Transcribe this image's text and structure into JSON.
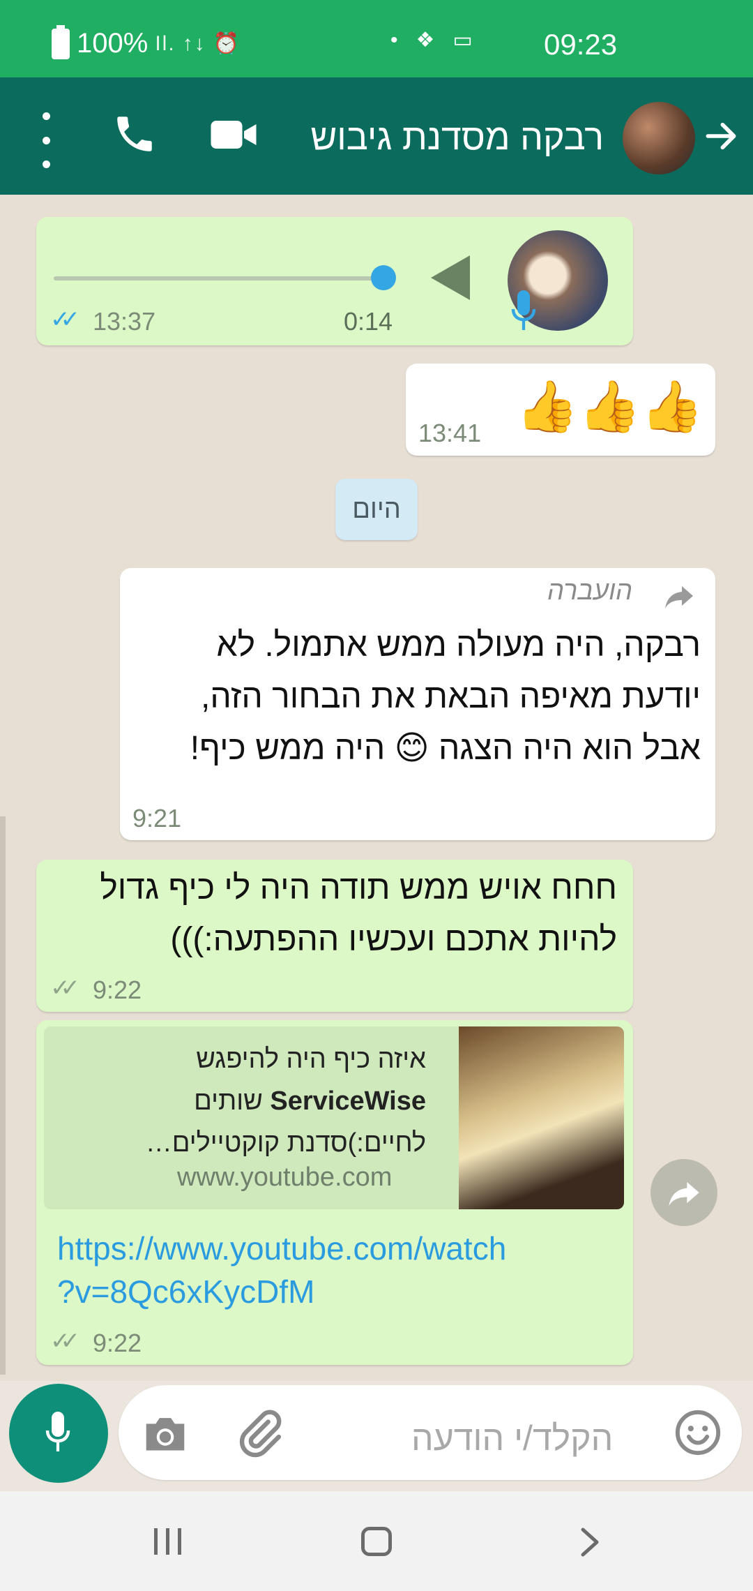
{
  "status_bar": {
    "battery": "100%",
    "time": "09:23",
    "signal_text": "Il.",
    "data_text": "↑↓"
  },
  "header": {
    "contact_name": "רבקה מסדנת גיבוש"
  },
  "messages": [
    {
      "type": "voice",
      "direction": "outgoing",
      "duration": "0:14",
      "time": "13:37",
      "ticks": "✓✓"
    },
    {
      "type": "emoji",
      "direction": "incoming",
      "content": "👍👍👍",
      "time": "13:41"
    },
    {
      "type": "date",
      "label": "היום"
    },
    {
      "type": "text",
      "direction": "incoming",
      "forwarded_label": "הועברה",
      "text": "רבקה, היה מעולה ממש אתמול. לא יודעת מאיפה הבאת את הבחור הזה, אבל הוא היה הצגה 😊 היה ממש כיף!",
      "time": "9:21"
    },
    {
      "type": "text",
      "direction": "outgoing",
      "text": "חחח אויש ממש תודה היה לי כיף גדול להיות אתכם ועכשיו ההפתעה:)))",
      "time": "9:22",
      "ticks": "✓✓"
    },
    {
      "type": "link",
      "direction": "outgoing",
      "preview_title_1": "איזה כיף היה להיפגש",
      "preview_title_2a": "ServiceWise",
      "preview_title_2b": "שותים",
      "preview_title_3": "לחיים:)סדנת קוקטיילים…",
      "preview_domain": "www.youtube.com",
      "url_line_1": "https://www.youtube.com/watch",
      "url_line_2": "?v=8Qc6xKycDfM",
      "time": "9:22",
      "ticks": "✓✓"
    }
  ],
  "input": {
    "placeholder": "הקלד/י הודעה"
  },
  "colors": {
    "header_bg": "#0b6b5d",
    "status_bg": "#1fae62",
    "outgoing_bubble": "#dcf8c6",
    "incoming_bubble": "#ffffff",
    "link": "#2b9be0",
    "mic_button": "#0d8f79",
    "read_ticks": "#34a6e3"
  },
  "icons": [
    "menu-icon",
    "call-icon",
    "video-icon",
    "back-arrow-icon",
    "play-icon",
    "mic-icon",
    "forward-icon",
    "share-icon",
    "emoji-icon",
    "attach-icon",
    "camera-icon",
    "nav-recent-icon",
    "nav-home-icon",
    "nav-back-icon"
  ]
}
